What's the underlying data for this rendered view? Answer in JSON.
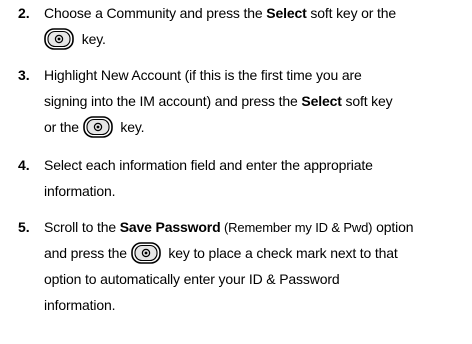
{
  "steps": [
    {
      "number": "2.",
      "lines": [
        {
          "t1": "Choose a Community and press the ",
          "b1": "Select",
          "t2": " soft key or the"
        },
        {
          "icon": "select-key-icon",
          "t1": " key."
        }
      ]
    },
    {
      "number": "3.",
      "lines": [
        {
          "t1": "Highlight New Account (if this is the first time you are"
        },
        {
          "t1": "signing into the IM account) and press the ",
          "b1": "Select",
          "t2": " soft key"
        },
        {
          "t1": "or the ",
          "icon": "select-key-icon",
          "t2": " key."
        }
      ]
    },
    {
      "number": "4.",
      "lines": [
        {
          "t1": "Select each information field and enter the appropriate"
        },
        {
          "t1": "information."
        }
      ]
    },
    {
      "number": "5.",
      "lines": [
        {
          "t1": "Scroll to the ",
          "b1": "Save Password",
          "s1": " (Remember my ID & Pwd)",
          "t2": " option"
        },
        {
          "t1": "and press the ",
          "icon": "select-key-icon",
          "t2": " key to place a check mark next to that"
        },
        {
          "t1": "option to automatically enter your ID & Password"
        },
        {
          "t1": "information."
        }
      ]
    }
  ]
}
